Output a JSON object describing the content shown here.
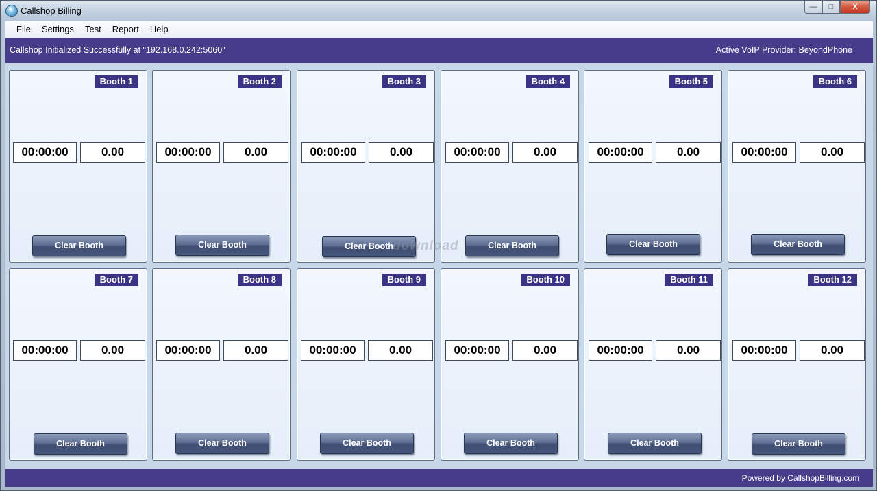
{
  "window": {
    "title": "Callshop Billing",
    "minimize": "—",
    "maximize": "□",
    "close": "X"
  },
  "menu": [
    "File",
    "Settings",
    "Test",
    "Report",
    "Help"
  ],
  "status": {
    "message": "Callshop Initialized Successfully at \"192.168.0.242:5060\"",
    "provider": "Active VoIP Provider: BeyondPhone"
  },
  "booths": [
    {
      "label": "Booth 1",
      "timer": "00:00:00",
      "cost": "0.00",
      "button": "Clear Booth"
    },
    {
      "label": "Booth 2",
      "timer": "00:00:00",
      "cost": "0.00",
      "button": "Clear Booth"
    },
    {
      "label": "Booth 3",
      "timer": "00:00:00",
      "cost": "0.00",
      "button": "Clear Booth"
    },
    {
      "label": "Booth 4",
      "timer": "00:00:00",
      "cost": "0.00",
      "button": "Clear Booth"
    },
    {
      "label": "Booth 5",
      "timer": "00:00:00",
      "cost": "0.00",
      "button": "Clear Booth"
    },
    {
      "label": "Booth 6",
      "timer": "00:00:00",
      "cost": "0.00",
      "button": "Clear Booth"
    },
    {
      "label": "Booth 7",
      "timer": "00:00:00",
      "cost": "0.00",
      "button": "Clear Booth"
    },
    {
      "label": "Booth 8",
      "timer": "00:00:00",
      "cost": "0.00",
      "button": "Clear Booth"
    },
    {
      "label": "Booth 9",
      "timer": "00:00:00",
      "cost": "0.00",
      "button": "Clear Booth"
    },
    {
      "label": "Booth 10",
      "timer": "00:00:00",
      "cost": "0.00",
      "button": "Clear Booth"
    },
    {
      "label": "Booth 11",
      "timer": "00:00:00",
      "cost": "0.00",
      "button": "Clear Booth"
    },
    {
      "label": "Booth 12",
      "timer": "00:00:00",
      "cost": "0.00",
      "button": "Clear Booth"
    }
  ],
  "footer": {
    "powered_by": "Powered by CallshopBilling.com"
  },
  "watermark": "download",
  "colors": {
    "accent": "#463c8a",
    "label_bg": "#3b3384",
    "panel_bg": "#e5eef9"
  }
}
